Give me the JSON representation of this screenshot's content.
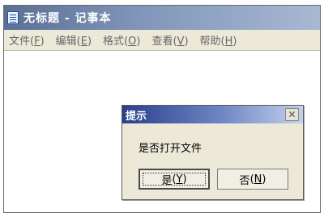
{
  "window": {
    "title": "无标题 - 记事本",
    "icon": "notepad-icon",
    "menu": [
      {
        "label": "文件",
        "hotkey": "F"
      },
      {
        "label": "编辑",
        "hotkey": "E"
      },
      {
        "label": "格式",
        "hotkey": "O"
      },
      {
        "label": "查看",
        "hotkey": "V"
      },
      {
        "label": "帮助",
        "hotkey": "H"
      }
    ]
  },
  "dialog": {
    "title": "提示",
    "close_glyph": "✕",
    "message": "是否打开文件",
    "buttons": [
      {
        "label": "是",
        "hotkey": "Y",
        "default": true
      },
      {
        "label": "否",
        "hotkey": "N",
        "default": false
      }
    ]
  },
  "colors": {
    "titlebar": "#5a6f94",
    "dialog_titlebar": "#2c3f8c",
    "menubar": "#ece9d8"
  }
}
